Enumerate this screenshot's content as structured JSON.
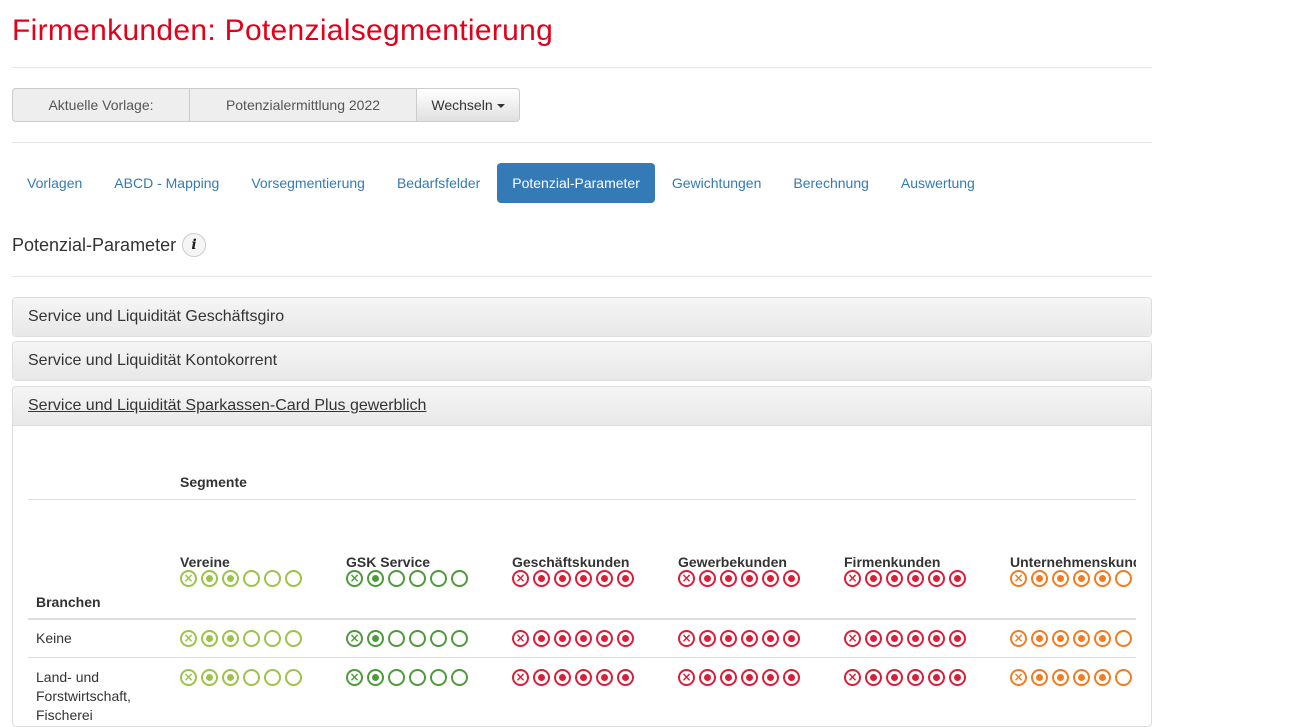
{
  "page": {
    "title": "Firmenkunden: Potenzialsegmentierung"
  },
  "template": {
    "label": "Aktuelle Vorlage:",
    "value": "Potenzialermittlung 2022",
    "switch_label": "Wechseln"
  },
  "nav": {
    "items": [
      "Vorlagen",
      "ABCD - Mapping",
      "Vorsegmentierung",
      "Bedarfsfelder",
      "Potenzial-Parameter",
      "Gewichtungen",
      "Berechnung",
      "Auswertung"
    ],
    "active": "Potenzial-Parameter"
  },
  "section": {
    "title": "Potenzial-Parameter",
    "info_icon": "info-icon"
  },
  "panels": [
    {
      "title": "Service und Liquidität Geschäftsgiro"
    },
    {
      "title": "Service und Liquidität Kontokorrent"
    },
    {
      "title": "Service und Liquidität Sparkassen-Card Plus gewerblich"
    }
  ],
  "matrix": {
    "segments_label": "Segmente",
    "branches_label": "Branchen",
    "columns": [
      {
        "name": "Vereine",
        "color": "#9dc34a",
        "levels": 2
      },
      {
        "name": "GSK Service",
        "color": "#4f9a3c",
        "levels": 1
      },
      {
        "name": "Geschäftskunden",
        "color": "#d9203a",
        "levels": 5
      },
      {
        "name": "Gewerbekunden",
        "color": "#d9203a",
        "levels": 5
      },
      {
        "name": "Firmenkunden",
        "color": "#d9203a",
        "levels": 5
      },
      {
        "name": "Unternehmenskunden",
        "color": "#f07d24",
        "levels": 4
      }
    ],
    "rows": [
      {
        "label": "Keine"
      },
      {
        "label": "Land- und Forstwirtschaft, Fischerei"
      }
    ]
  }
}
